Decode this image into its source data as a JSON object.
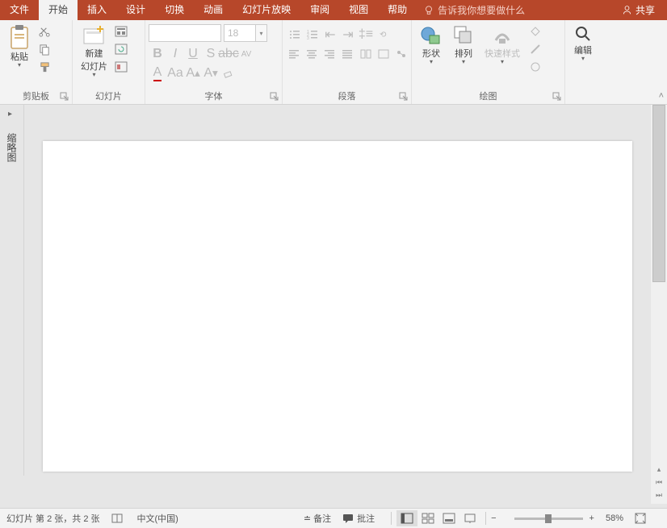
{
  "tabs": {
    "file": "文件",
    "home": "开始",
    "insert": "插入",
    "design": "设计",
    "transitions": "切换",
    "animations": "动画",
    "slideshow": "幻灯片放映",
    "review": "审阅",
    "view": "视图",
    "help": "帮助"
  },
  "tellme": "告诉我你想要做什么",
  "share": "共享",
  "groups": {
    "clipboard": {
      "label": "剪贴板",
      "paste": "粘贴"
    },
    "slides": {
      "label": "幻灯片",
      "newslide": "新建\n幻灯片"
    },
    "font": {
      "label": "字体",
      "size": "18"
    },
    "paragraph": {
      "label": "段落"
    },
    "drawing": {
      "label": "绘图",
      "shapes": "形状",
      "arrange": "排列",
      "quickstyle": "快速样式"
    },
    "editing": {
      "label": "编辑"
    }
  },
  "sidebar": {
    "label": "缩略图"
  },
  "status": {
    "slideinfo": "幻灯片 第 2 张，共 2 张",
    "lang": "中文(中国)",
    "notes": "备注",
    "comments": "批注",
    "zoom": "58%"
  }
}
